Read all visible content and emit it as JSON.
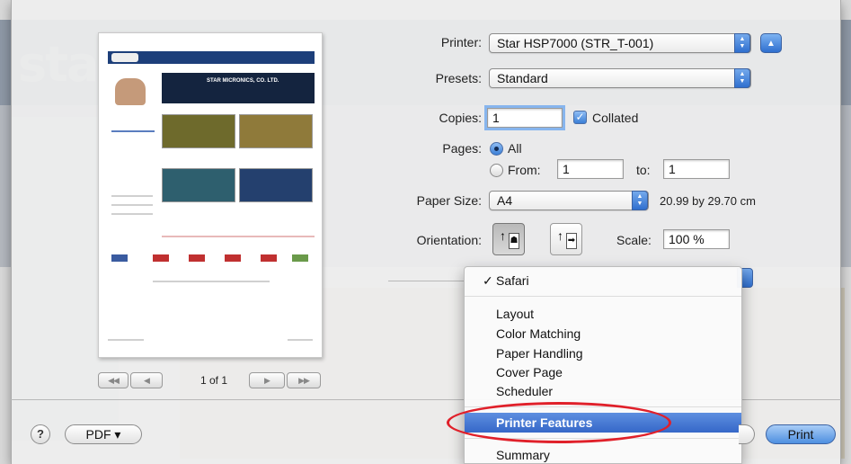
{
  "printer": {
    "label": "Printer:",
    "value": "Star HSP7000 (STR_T-001)"
  },
  "presets": {
    "label": "Presets:",
    "value": "Standard"
  },
  "copies": {
    "label": "Copies:",
    "value": "1",
    "collated_label": "Collated",
    "collated_checked": true
  },
  "pages": {
    "label": "Pages:",
    "all_label": "All",
    "from_label": "From:",
    "from_value": "1",
    "to_label": "to:",
    "to_value": "1"
  },
  "paper_size": {
    "label": "Paper Size:",
    "value": "A4",
    "dimensions": "20.99 by 29.70 cm"
  },
  "orientation": {
    "label": "Orientation:"
  },
  "scale": {
    "label": "Scale:",
    "value": "100 %"
  },
  "preview": {
    "page_indicator": "1 of 1",
    "thumbnail_banner": "STAR MICRONICS, CO. LTD."
  },
  "menu": {
    "selected": "Safari",
    "items": [
      "Layout",
      "Color Matching",
      "Paper Handling",
      "Cover Page",
      "Scheduler"
    ],
    "highlighted": "Printer Features",
    "after": [
      "Summary"
    ]
  },
  "footer": {
    "help": "?",
    "pdf": "PDF ▾",
    "print": "Print"
  },
  "icons": {
    "first-page": "◀◀",
    "prev-page": "◀",
    "next-page": "▶",
    "last-page": "▶▶",
    "disclosure": "▲",
    "check": "✓"
  },
  "colors": {
    "accent": "#3567c8",
    "annotation": "#e0202a"
  }
}
